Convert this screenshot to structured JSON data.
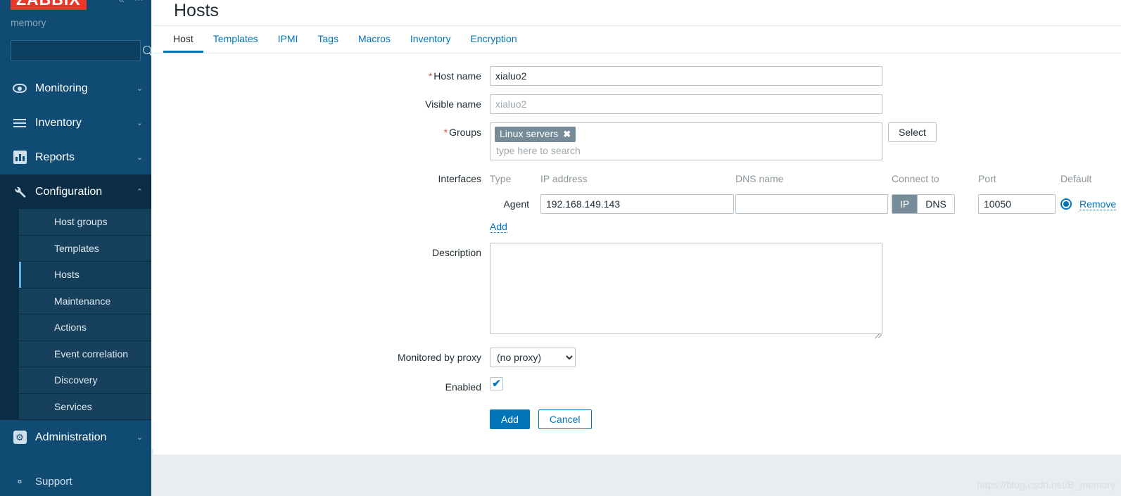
{
  "sidebar": {
    "logo": "ZABBIX",
    "user": "memory",
    "search_placeholder": "",
    "search_value": "",
    "collapse_icon": "chevron-double-left-icon",
    "hide_icon": "hide-sidebar-icon",
    "items": [
      {
        "label": "Monitoring",
        "icon": "eye-icon",
        "chevron": "⌄",
        "active": false
      },
      {
        "label": "Inventory",
        "icon": "list-icon",
        "chevron": "⌄",
        "active": false
      },
      {
        "label": "Reports",
        "icon": "bar-chart-icon",
        "chevron": "⌄",
        "active": false
      },
      {
        "label": "Configuration",
        "icon": "wrench-icon",
        "chevron": "⌃",
        "active": true
      },
      {
        "label": "Administration",
        "icon": "gear-icon",
        "chevron": "⌄",
        "active": false
      }
    ],
    "submenu": [
      {
        "label": "Host groups",
        "active": false
      },
      {
        "label": "Templates",
        "active": false
      },
      {
        "label": "Hosts",
        "active": true
      },
      {
        "label": "Maintenance",
        "active": false
      },
      {
        "label": "Actions",
        "active": false
      },
      {
        "label": "Event correlation",
        "active": false
      },
      {
        "label": "Discovery",
        "active": false
      },
      {
        "label": "Services",
        "active": false
      }
    ],
    "support": {
      "label": "Support",
      "icon": "headset-icon"
    }
  },
  "page": {
    "title": "Hosts",
    "watermark": "https://blog.csdn.net/B_memory"
  },
  "tabs": [
    {
      "label": "Host",
      "active": true
    },
    {
      "label": "Templates",
      "active": false
    },
    {
      "label": "IPMI",
      "active": false
    },
    {
      "label": "Tags",
      "active": false
    },
    {
      "label": "Macros",
      "active": false
    },
    {
      "label": "Inventory",
      "active": false
    },
    {
      "label": "Encryption",
      "active": false
    }
  ],
  "form": {
    "host_name": {
      "label": "Host name",
      "required": "*",
      "value": "xialuo2"
    },
    "visible_name": {
      "label": "Visible name",
      "value": "",
      "placeholder": "xialuo2"
    },
    "groups": {
      "label": "Groups",
      "required": "*",
      "chips": [
        {
          "label": "Linux servers",
          "remove": "✖"
        }
      ],
      "placeholder": "type here to search",
      "select_button": "Select"
    },
    "interfaces": {
      "label": "Interfaces",
      "headers": {
        "type": "Type",
        "ip": "IP address",
        "dns": "DNS name",
        "connect_to": "Connect to",
        "port": "Port",
        "default": "Default"
      },
      "rows": [
        {
          "type": "Agent",
          "ip": "192.168.149.143",
          "dns": "",
          "connect_ip": "IP",
          "connect_dns": "DNS",
          "connect_selected": "IP",
          "port": "10050",
          "default_selected": true,
          "remove": "Remove"
        }
      ],
      "add_link": "Add"
    },
    "description": {
      "label": "Description",
      "value": ""
    },
    "proxy": {
      "label": "Monitored by proxy",
      "value": "(no proxy)",
      "options": [
        "(no proxy)"
      ]
    },
    "enabled": {
      "label": "Enabled",
      "checked": true,
      "mark": "✔"
    },
    "actions": {
      "submit": "Add",
      "cancel": "Cancel"
    }
  },
  "colors": {
    "brand_red": "#e8372b",
    "sidebar_bg": "#0f4b72",
    "sidebar_active": "#0a2d45",
    "accent_blue": "#0275b8",
    "chip_gray": "#768d99",
    "required_red": "#d9534f"
  }
}
